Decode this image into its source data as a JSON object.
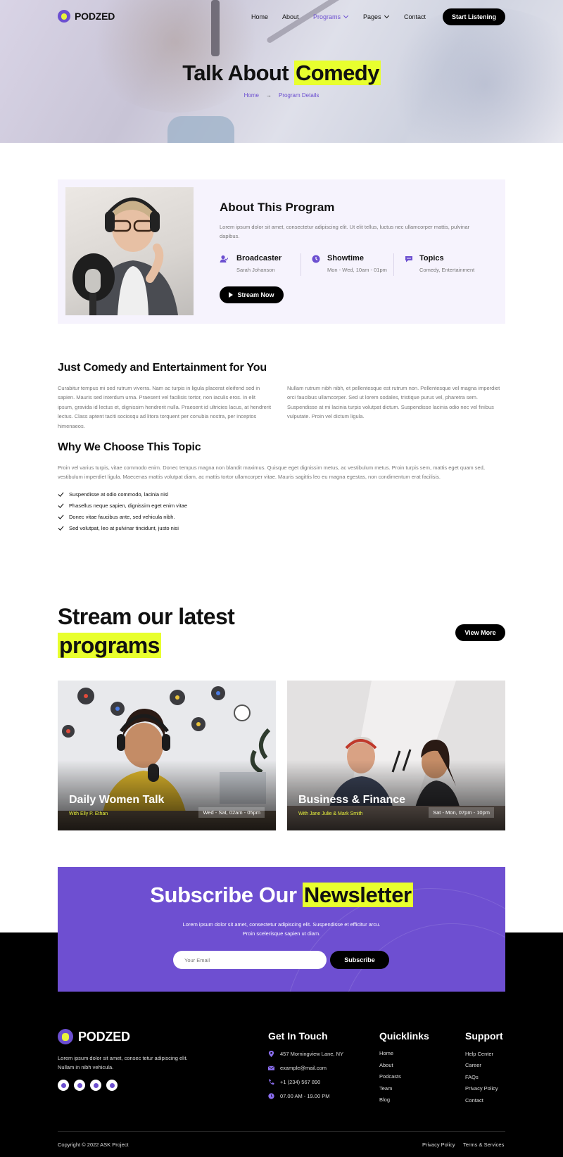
{
  "brand": {
    "name": "PODZED",
    "accent": "#6c4fd0",
    "highlight": "#e8ff2e"
  },
  "nav": {
    "items": [
      {
        "label": "Home"
      },
      {
        "label": "About"
      },
      {
        "label": "Programs"
      },
      {
        "label": "Pages"
      },
      {
        "label": "Contact"
      }
    ],
    "cta": "Start Listening"
  },
  "hero": {
    "title_plain": "Talk About",
    "title_highlight": "Comedy",
    "breadcrumb": {
      "home": "Home",
      "current": "Program Details"
    }
  },
  "program": {
    "title": "About This Program",
    "description": "Lorem ipsum dolor sit amet, consectetur adipiscing elit. Ut elit tellus, luctus nec ullamcorper mattis, pulvinar dapibus.",
    "meta": [
      {
        "label": "Broadcaster",
        "value": "Sarah Johanson",
        "icon": "user-icon"
      },
      {
        "label": "Showtime",
        "value": "Mon - Wed, 10am - 01pm",
        "icon": "clock-icon"
      },
      {
        "label": "Topics",
        "value": "Comedy, Entertainment",
        "icon": "chat-icon"
      }
    ],
    "stream_button": "Stream Now"
  },
  "section1": {
    "title": "Just Comedy and Entertainment for You",
    "col1": "Curabitur tempus mi sed rutrum viverra. Nam ac turpis in ligula placerat eleifend sed in sapien. Mauris sed interdum urna. Praesent vel facilisis tortor, non iaculis eros. In elit ipsum, gravida id lectus et, dignissim hendrerit nulla. Praesent id ultricies lacus, at hendrerit lectus. Class aptent taciti sociosqu ad litora torquent per conubia nostra, per inceptos himenaeos.",
    "col2": "Nullam rutrum nibh nibh, et pellentesque est rutrum non. Pellentesque vel magna imperdiet orci faucibus ullamcorper. Sed ut lorem sodales, tristique purus vel, pharetra sem. Suspendisse at mi lacinia turpis volutpat dictum. Suspendisse lacinia odio nec vel finibus vulputate. Proin vel dictum ligula."
  },
  "section2": {
    "title": "Why We Choose This Topic",
    "text": "Proin vel varius turpis, vitae commodo enim. Donec tempus magna non blandit maximus. Quisque eget dignissim metus, ac vestibulum metus. Proin turpis sem, mattis eget quam sed, vestibulum imperdiet ligula. Maecenas mattis volutpat diam, ac mattis tortor ullamcorper vitae. Mauris sagittis leo eu magna egestas, non condimentum erat facilisis.",
    "checks": [
      "Suspendisse at odio commodo, lacinia nisl",
      "Phasellus neque sapien, dignissim eget enim vitae",
      "Donec vitae faucibus ante, sed vehicula nibh.",
      "Sed volutpat, leo at pulvinar tincidunt, justo nisi"
    ]
  },
  "stream": {
    "title_line1": "Stream our latest",
    "title_highlight": "programs",
    "view_more": "View More",
    "cards": [
      {
        "title": "Daily Women Talk",
        "host": "With Elly P. Ethan",
        "time": "Wed - Sat, 02am - 05pm"
      },
      {
        "title": "Business & Finance",
        "host": "With Jane Julie & Mark Smith",
        "time": "Sat - Mon, 07pm - 10pm"
      }
    ]
  },
  "newsletter": {
    "title_plain": "Subscribe Our",
    "title_highlight": "Newsletter",
    "desc_line1": "Lorem ipsum dolor sit amet, consectetur adipiscing elit. Suspendisse et efficitur arcu.",
    "desc_line2": "Proin scelerisque sapien ut diam.",
    "placeholder": "Your Email",
    "button": "Subscribe"
  },
  "footer": {
    "about": "Lorem ipsum dolor sit amet, consec tetur adipiscing elit. Nullam in nibh vehicula.",
    "contact": {
      "title": "Get In Touch",
      "address": "457 Morningview Lane, NY",
      "email": "example@mail.com",
      "phone": "+1 (234) 567 890",
      "hours": "07.00 AM - 19.00 PM"
    },
    "quicklinks": {
      "title": "Quicklinks",
      "items": [
        "Home",
        "About",
        "Podcasts",
        "Team",
        "Blog"
      ]
    },
    "support": {
      "title": "Support",
      "items": [
        "Help Center",
        "Career",
        "FAQs",
        "Privacy Policy",
        "Contact"
      ]
    },
    "copyright": "Copyright © 2022 ASK Project",
    "legal": [
      "Privacy Policy",
      "Terms & Services"
    ]
  }
}
